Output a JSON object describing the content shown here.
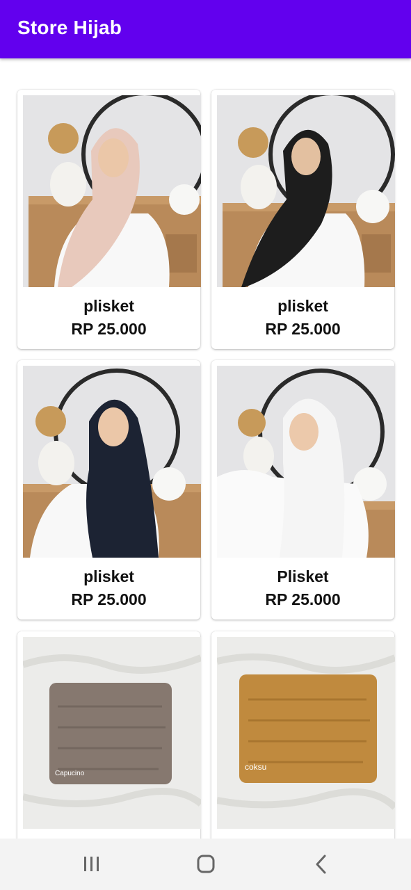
{
  "app_bar": {
    "title": "Store Hijab",
    "color": "#6200ee"
  },
  "products": [
    {
      "name": "plisket",
      "price": "RP 25.000",
      "image": "model-hijab-blush",
      "hijab_color": "#e8c9bc"
    },
    {
      "name": "plisket",
      "price": "RP 25.000",
      "image": "model-hijab-black",
      "hijab_color": "#1d1d1d"
    },
    {
      "name": "plisket",
      "price": "RP 25.000",
      "image": "model-hijab-navy",
      "hijab_color": "#1c2333"
    },
    {
      "name": "Plisket",
      "price": "RP 25.000",
      "image": "model-hijab-white",
      "hijab_color": "#f5f5f5"
    },
    {
      "name": "",
      "price": "",
      "image": "folded-scarf-gray",
      "scarf_color": "#86786f",
      "photo_label": "Capucino"
    },
    {
      "name": "",
      "price": "",
      "image": "folded-scarf-mustard",
      "scarf_color": "#c08a3e",
      "photo_label": "coksu"
    }
  ],
  "nav_bar": {
    "icons": [
      "recents-icon",
      "home-icon",
      "back-icon"
    ]
  }
}
